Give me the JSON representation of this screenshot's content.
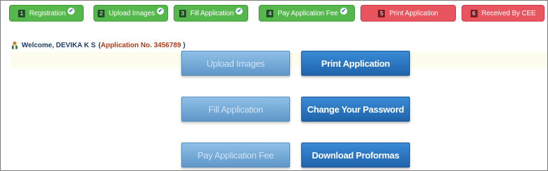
{
  "steps": [
    {
      "num": "1",
      "label": "Registration",
      "status": "done"
    },
    {
      "num": "2",
      "label": "Upload Images",
      "status": "done"
    },
    {
      "num": "3",
      "label": "Fill Application",
      "status": "done"
    },
    {
      "num": "4",
      "label": "Pay Application Fee",
      "status": "done"
    },
    {
      "num": "5",
      "label": "Print Application",
      "status": "pending"
    },
    {
      "num": "6",
      "label": "Received By CEE",
      "status": "pending"
    }
  ],
  "check_glyph": "✔",
  "welcome": {
    "prefix": "Welcome, DEVIKA K S",
    "open_paren": "(",
    "app_label": "Application No. 3456789",
    "close_paren": ")"
  },
  "actions": {
    "upload_images": "Upload Images",
    "print_application": "Print Application",
    "fill_application": "Fill Application",
    "change_password": "Change Your Password",
    "pay_fee": "Pay Application Fee",
    "download_proformas": "Download Proformas"
  },
  "colors": {
    "step_done": "#56b84c",
    "step_pending": "#e8555e",
    "button_active": "#1f64ac",
    "button_disabled": "#7fb3e0",
    "welcome_text": "#1f3d6b",
    "app_number": "#b13a15"
  }
}
